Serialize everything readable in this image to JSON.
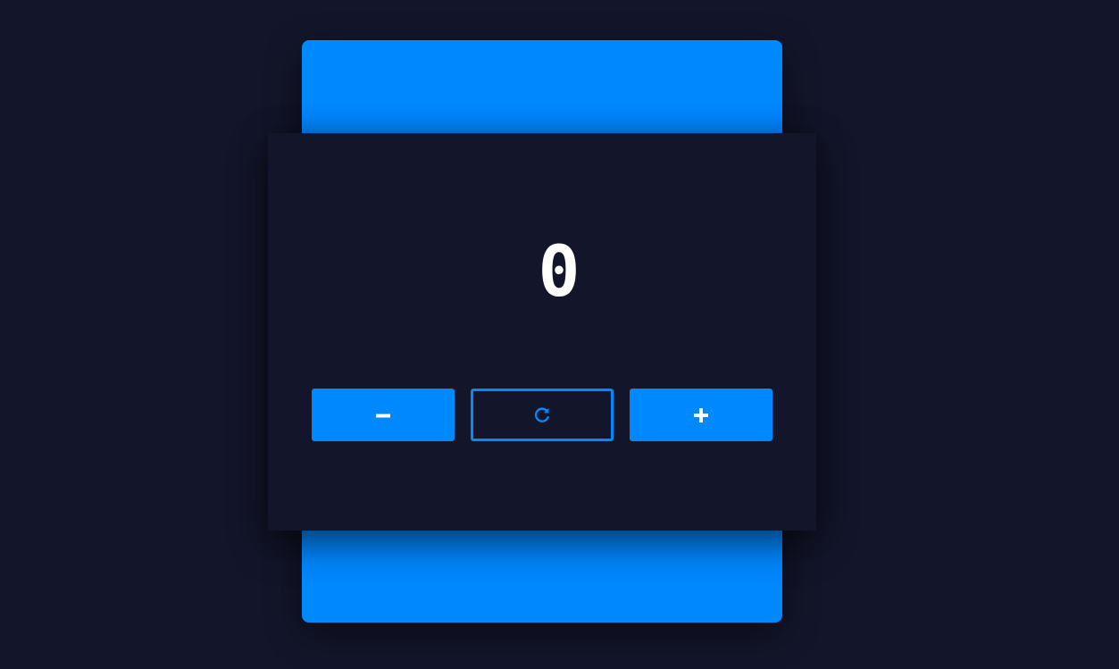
{
  "counter": {
    "value": "0"
  },
  "controls": {
    "decrement_icon": "minus-icon",
    "reset_icon": "reset-icon",
    "increment_icon": "plus-icon"
  },
  "colors": {
    "background": "#13152a",
    "accent": "#0088ff",
    "text": "#ffffff"
  }
}
